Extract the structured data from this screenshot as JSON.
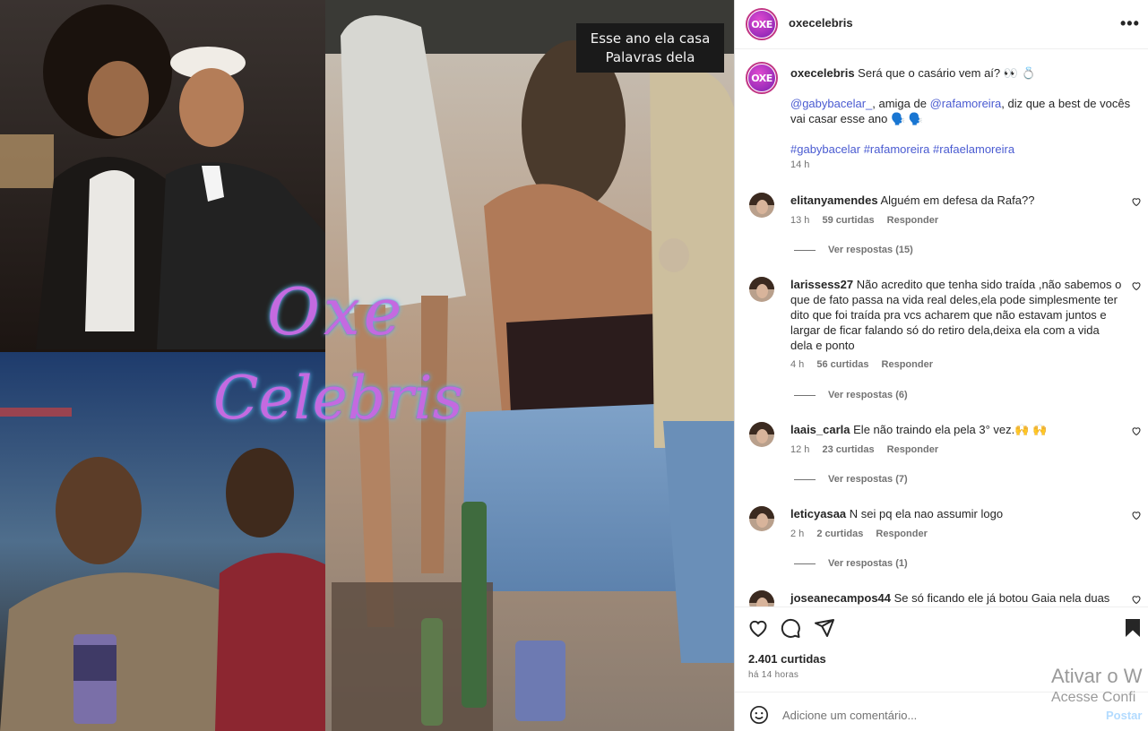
{
  "media": {
    "overlay_caption_line1": "Esse ano ela casa",
    "overlay_caption_line2": "Palavras dela",
    "watermark_line1": "Oxe",
    "watermark_line2": "Celebris"
  },
  "header": {
    "username": "oxecelebris",
    "avatar_text": "OXE",
    "more_icon": "more-horizontal-icon"
  },
  "caption": {
    "username": "oxecelebris",
    "text_intro": "Será que o casário vem aí? 👀 💍",
    "mention1": "@gabybacelar_",
    "text_mid": ", amiga de ",
    "mention2": "@rafamoreira",
    "text_end": ", diz que a best de vocês vai casar esse ano 🗣️ 🗣️",
    "hashtag1": "#gabybacelar",
    "hashtag2": "#rafamoreira",
    "hashtag3": "#rafaelamoreira",
    "time": "14 h"
  },
  "comments": [
    {
      "username": "elitanyamendes",
      "text": "Alguém em defesa da Rafa??",
      "time": "13 h",
      "likes": "59 curtidas",
      "reply": "Responder",
      "view_replies": "Ver respostas (15)"
    },
    {
      "username": "larissess27",
      "text": "Não acredito que tenha sido traída ,não sabemos o que de fato passa na vida real deles,ela pode simplesmente ter dito que foi traída pra vcs acharem que não estavam juntos e largar de ficar falando só do retiro dela,deixa ela com a vida dela e ponto",
      "time": "4 h",
      "likes": "56 curtidas",
      "reply": "Responder",
      "view_replies": "Ver respostas (6)"
    },
    {
      "username": "laais_carla",
      "text": "Ele não traindo ela pela 3° vez.🙌 🙌",
      "time": "12 h",
      "likes": "23 curtidas",
      "reply": "Responder",
      "view_replies": "Ver respostas (7)"
    },
    {
      "username": "leticyasaa",
      "text": "N sei pq ela nao assumir logo",
      "time": "2 h",
      "likes": "2 curtidas",
      "reply": "Responder",
      "view_replies": "Ver respostas (1)"
    },
    {
      "username": "joseanecampos44",
      "text": "Se só ficando ele já botou Gaia nela duas",
      "time": "",
      "likes": "",
      "reply": "",
      "view_replies": ""
    }
  ],
  "actions": {
    "like_icon": "heart-icon",
    "comment_icon": "comment-icon",
    "share_icon": "send-icon",
    "save_icon": "bookmark-icon",
    "likes_count": "2.401 curtidas",
    "posted_ago": "há 14 horas"
  },
  "add_comment": {
    "emoji_icon": "emoji-icon",
    "placeholder": "Adicione um comentário...",
    "post_label": "Postar"
  },
  "windows_overlay": {
    "line1": "Ativar o W",
    "line2": "Acesse Confi"
  },
  "colors": {
    "link": "#4a5bd1",
    "post_disabled": "#b3dbff",
    "avatar_ring": "#c13584",
    "meta_gray": "#737373"
  }
}
